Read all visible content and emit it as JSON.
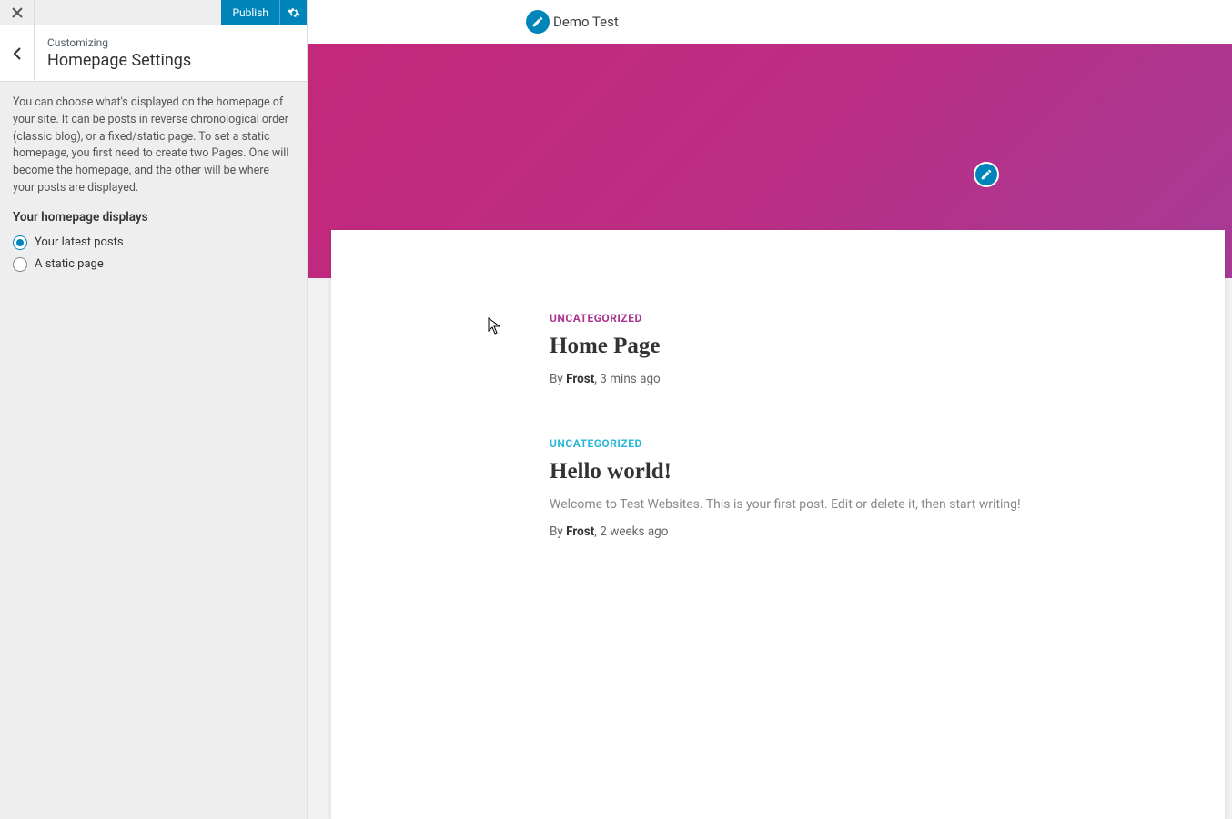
{
  "sidebar": {
    "publish_label": "Publish",
    "customizing_label": "Customizing",
    "panel_title": "Homepage Settings",
    "description": "You can choose what's displayed on the homepage of your site. It can be posts in reverse chronological order (classic blog), or a fixed/static page. To set a static homepage, you first need to create two Pages. One will become the homepage, and the other will be where your posts are displayed.",
    "section_label": "Your homepage displays",
    "options": {
      "latest_posts": "Your latest posts",
      "static_page": "A static page"
    }
  },
  "preview": {
    "site_title": "Demo Test",
    "posts": [
      {
        "category": "UNCATEGORIZED",
        "title": "Home Page",
        "excerpt": "",
        "by_label": "By ",
        "author": "Frost",
        "sep": ", ",
        "time": "3 mins ago"
      },
      {
        "category": "UNCATEGORIZED",
        "title": "Hello world!",
        "excerpt": "Welcome to Test Websites. This is your first post. Edit or delete it, then start writing!",
        "by_label": "By ",
        "author": "Frost",
        "sep": ", ",
        "time": "2 weeks ago"
      }
    ]
  }
}
